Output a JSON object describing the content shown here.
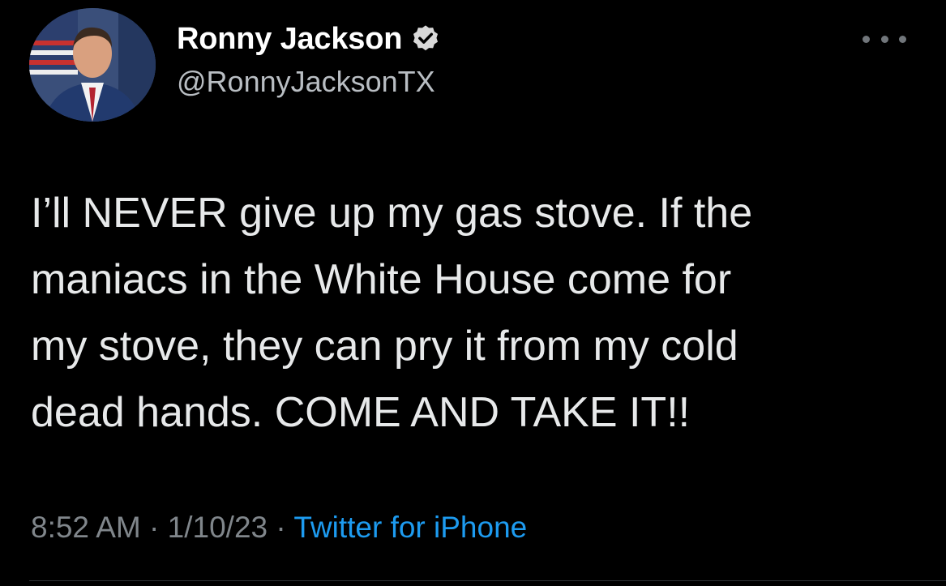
{
  "author": {
    "display_name": "Ronny Jackson",
    "handle": "@RonnyJacksonTX",
    "verified": true,
    "avatar_icon": "profile-photo"
  },
  "menu": {
    "icon": "more-horizontal-icon"
  },
  "tweet": {
    "text": "I’ll NEVER give up my gas stove. If the\nmaniacs in the White House come for\nmy stove, they can pry it from my cold\ndead hands. COME AND TAKE IT!!"
  },
  "meta": {
    "time": "8:52 AM",
    "separator": " · ",
    "date": "1/10/23",
    "source": "Twitter for iPhone"
  },
  "colors": {
    "background": "#000000",
    "text": "#e7e9ea",
    "secondary": "#80868b",
    "link": "#1d9bf0",
    "verified_badge": "#d9d9d9"
  }
}
